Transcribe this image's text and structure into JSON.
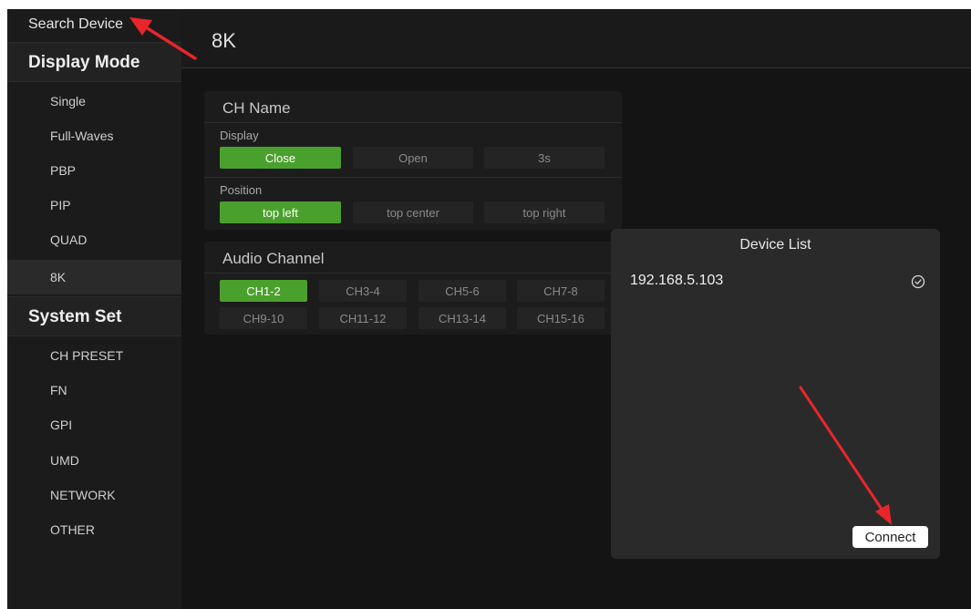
{
  "sidebar": {
    "search_device": "Search Device",
    "display_mode": {
      "title": "Display Mode",
      "items": [
        "Single",
        "Full-Waves",
        "PBP",
        "PIP",
        "QUAD",
        "8K"
      ],
      "active": "8K"
    },
    "system_set": {
      "title": "System Set",
      "items": [
        "CH PRESET",
        "FN",
        "GPI",
        "UMD",
        "NETWORK",
        "OTHER"
      ]
    }
  },
  "header": {
    "title": "8K"
  },
  "ch_name": {
    "title": "CH Name",
    "display": {
      "label": "Display",
      "options": [
        "Close",
        "Open",
        "3s"
      ],
      "selected": "Close"
    },
    "position": {
      "label": "Position",
      "options": [
        "top left",
        "top center",
        "top right"
      ],
      "selected": "top left"
    }
  },
  "audio_channel": {
    "title": "Audio Channel",
    "options": [
      "CH1-2",
      "CH3-4",
      "CH5-6",
      "CH7-8",
      "CH9-10",
      "CH11-12",
      "CH13-14",
      "CH15-16"
    ],
    "selected": "CH1-2"
  },
  "device_list": {
    "title": "Device List",
    "devices": [
      {
        "ip": "192.168.5.103",
        "icon": "check-circle-icon"
      }
    ],
    "connect_label": "Connect"
  },
  "colors": {
    "accent": "#4aa02c",
    "annotation_arrow": "#e8262a"
  }
}
